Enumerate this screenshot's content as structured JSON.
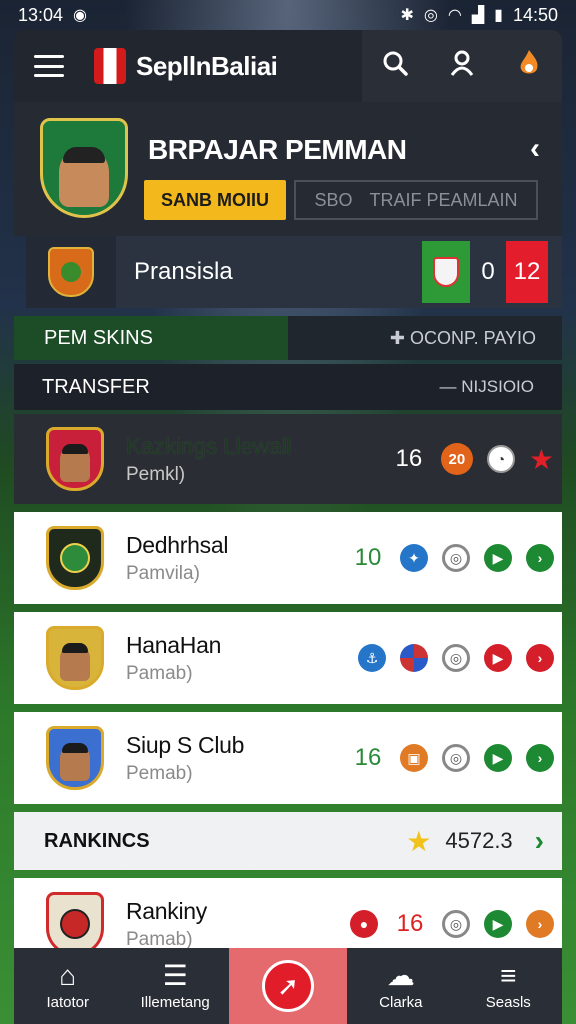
{
  "status_bar": {
    "time_left": "13:04",
    "time_right": "14:50"
  },
  "header": {
    "brand": "SepllnBaliai"
  },
  "player": {
    "title": "BRPAJAR PEMMAN",
    "primary_button": "SANB MOIIU",
    "secondary_button_left": "SBO",
    "secondary_button_right": "TRAIF PEAMLAIN"
  },
  "match": {
    "name": "Pransisla",
    "score_mid": "0",
    "score_right": "12"
  },
  "skins": {
    "title": "PEM SKINS",
    "right": "✚ OCONP. PAYIO"
  },
  "transfer": {
    "title": "TRANSFER",
    "right": "— NIJSIOIO"
  },
  "items": [
    {
      "name": "Kazkings Llewall",
      "sub": "Pemkl)",
      "value": "16",
      "badge": "20"
    },
    {
      "name": "Dedhrhsal",
      "sub": "Pamvila)",
      "value": "10"
    },
    {
      "name": "HanaHan",
      "sub": "Pamab)",
      "value": ""
    },
    {
      "name": "Siup S Club",
      "sub": "Pemab)",
      "value": "16"
    }
  ],
  "rankings": {
    "title": "RANKINCS",
    "value": "4572.3"
  },
  "last_item": {
    "name": "Rankiny",
    "sub": "Pamab)",
    "value": "16"
  },
  "nav": [
    {
      "label": "Iatotor"
    },
    {
      "label": "Illemetang"
    },
    {
      "label": ""
    },
    {
      "label": "Clarka"
    },
    {
      "label": "Seasls"
    }
  ]
}
